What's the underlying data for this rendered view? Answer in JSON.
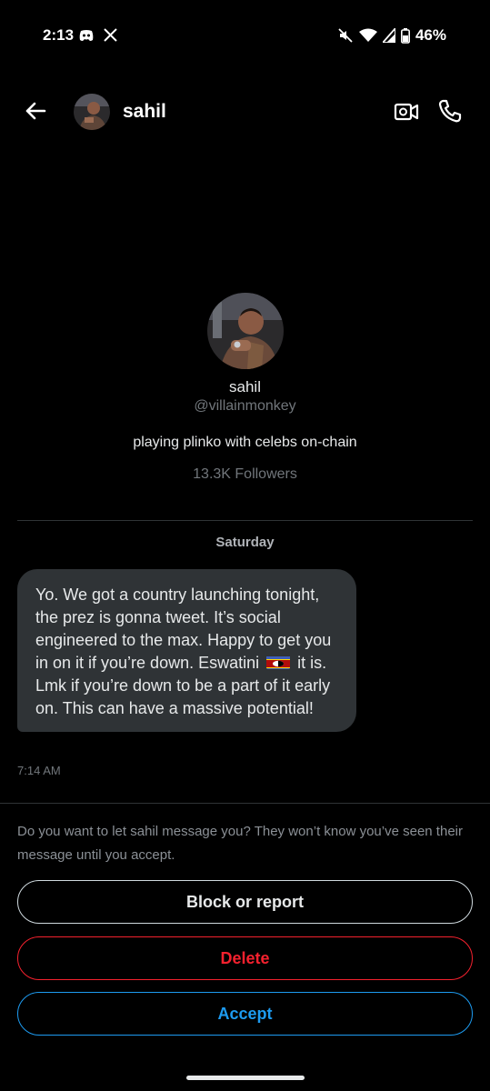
{
  "status_bar": {
    "time": "2:13",
    "battery": "46%",
    "left_icons": [
      "discord-icon",
      "x-logo-icon"
    ],
    "right_icons": [
      "mute-icon",
      "wifi-icon",
      "signal-icon",
      "battery-icon"
    ]
  },
  "header": {
    "name": "sahil"
  },
  "profile": {
    "name": "sahil",
    "handle": "@villainmonkey",
    "bio": "playing plinko with celebs on-chain",
    "followers": "13.3K Followers"
  },
  "conversation": {
    "date_separator": "Saturday",
    "message": {
      "text_before_flag": "Yo. We got a country launching tonight, the prez is gonna tweet. It’s social engineered to the max. Happy to get you in on it if you’re down. Eswatini",
      "text_after_flag": "it is. Lmk if you’re down to be a part of it early on. This can have a massive potential!",
      "time": "7:14 AM"
    }
  },
  "request": {
    "prompt": "Do you want to let sahil message you? They won’t know you’ve seen their message until you accept.",
    "block_label": "Block or report",
    "delete_label": "Delete",
    "accept_label": "Accept"
  },
  "colors": {
    "background": "#000000",
    "bubble": "#2f3336",
    "delete": "#f4212e",
    "accept": "#1d9bf0"
  }
}
